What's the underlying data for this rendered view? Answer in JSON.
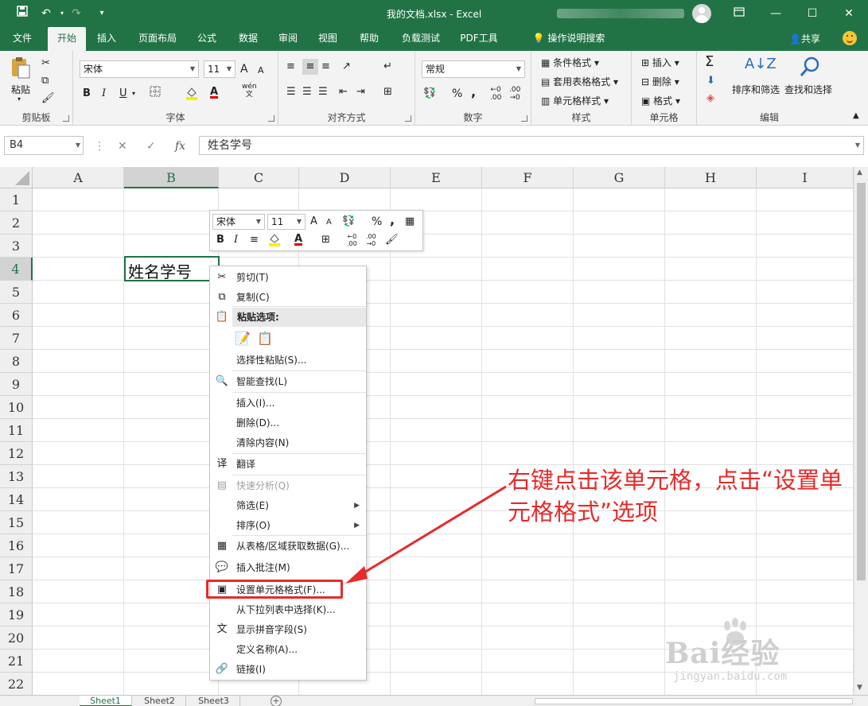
{
  "window": {
    "title": "我的文档.xlsx  -  Excel",
    "controls": [
      "restore-ribbon",
      "minimize",
      "maximize",
      "close"
    ]
  },
  "ribbon_tabs": [
    "文件",
    "开始",
    "插入",
    "页面布局",
    "公式",
    "数据",
    "审阅",
    "视图",
    "帮助",
    "负载测试",
    "PDF工具"
  ],
  "active_tab": "开始",
  "tell_me": "操作说明搜索",
  "share": "共享",
  "groups": {
    "clipboard": {
      "label": "剪贴板",
      "paste": "粘贴"
    },
    "font": {
      "label": "字体",
      "font_name": "宋体",
      "font_size": "11",
      "bold": "B",
      "italic": "I",
      "underline": "U",
      "font_color": "A",
      "grow": "A",
      "shrink": "A",
      "phonetic": "wén"
    },
    "align": {
      "label": "对齐方式"
    },
    "number": {
      "label": "数字",
      "format": "常规",
      "percent": "%",
      "comma": ","
    },
    "styles": {
      "label": "样式",
      "conditional": "条件格式",
      "table_format": "套用表格格式",
      "cell_style": "单元格样式"
    },
    "cells": {
      "label": "单元格",
      "insert": "插入",
      "delete": "删除",
      "format": "格式"
    },
    "editing": {
      "label": "编辑",
      "sort_filter": "排序和筛选",
      "find_select": "查找和选择"
    }
  },
  "formula_bar": {
    "name_box": "B4",
    "cancel": "✕",
    "enter": "✓",
    "fx": "fx",
    "content": "姓名学号"
  },
  "columns": [
    "A",
    "B",
    "C",
    "D",
    "E",
    "F",
    "G",
    "H",
    "I"
  ],
  "rows": [
    "1",
    "2",
    "3",
    "4",
    "5",
    "6",
    "7",
    "8",
    "9",
    "10",
    "11",
    "12",
    "13",
    "14",
    "15",
    "16",
    "17",
    "18",
    "19",
    "20",
    "21",
    "22"
  ],
  "active_cell": {
    "ref": "B4",
    "value": "姓名学号"
  },
  "mini_toolbar": {
    "font_name": "宋体",
    "font_size": "11",
    "grow": "A",
    "shrink": "A",
    "percent": "%",
    "comma": ",",
    "bold": "B",
    "italic": "I",
    "font_color": "A"
  },
  "context_menu": {
    "items": [
      {
        "label": "剪切(T)",
        "icon": "scissors-icon"
      },
      {
        "label": "复制(C)",
        "icon": "copy-icon"
      },
      {
        "label": "粘贴选项:",
        "icon": "paste-icon",
        "header": true
      },
      {
        "label": "选择性粘贴(S)...",
        "icon": ""
      },
      {
        "label": "智能查找(L)",
        "icon": "smart-lookup-icon"
      },
      {
        "label": "插入(I)...",
        "icon": ""
      },
      {
        "label": "删除(D)...",
        "icon": ""
      },
      {
        "label": "清除内容(N)",
        "icon": ""
      },
      {
        "label": "翻译",
        "icon": "translate-icon"
      },
      {
        "label": "快速分析(Q)",
        "icon": "quick-analysis-icon",
        "disabled": true
      },
      {
        "label": "筛选(E)",
        "icon": "",
        "submenu": true
      },
      {
        "label": "排序(O)",
        "icon": "",
        "submenu": true
      },
      {
        "label": "从表格/区域获取数据(G)...",
        "icon": "table-icon"
      },
      {
        "label": "插入批注(M)",
        "icon": "comment-icon"
      },
      {
        "label": "设置单元格格式(F)...",
        "icon": "format-cells-icon",
        "highlighted": true
      },
      {
        "label": "从下拉列表中选择(K)...",
        "icon": ""
      },
      {
        "label": "显示拼音字段(S)",
        "icon": "phonetic-icon"
      },
      {
        "label": "定义名称(A)...",
        "icon": ""
      },
      {
        "label": "链接(I)",
        "icon": "link-icon"
      }
    ]
  },
  "annotation": {
    "text": "右键点击该单元格，点击“设置单元格格式”选项",
    "color": "#e52b2b"
  },
  "sheets": [
    "Sheet1",
    "Sheet2",
    "Sheet3"
  ],
  "active_sheet": "Sheet1",
  "watermark": {
    "logo": "Bai经验",
    "url": "jingyan.baidu.com"
  },
  "colors": {
    "excel_green": "#217346",
    "ribbon_bg": "#f3f3f3",
    "annotation_red": "#e52b2b"
  }
}
